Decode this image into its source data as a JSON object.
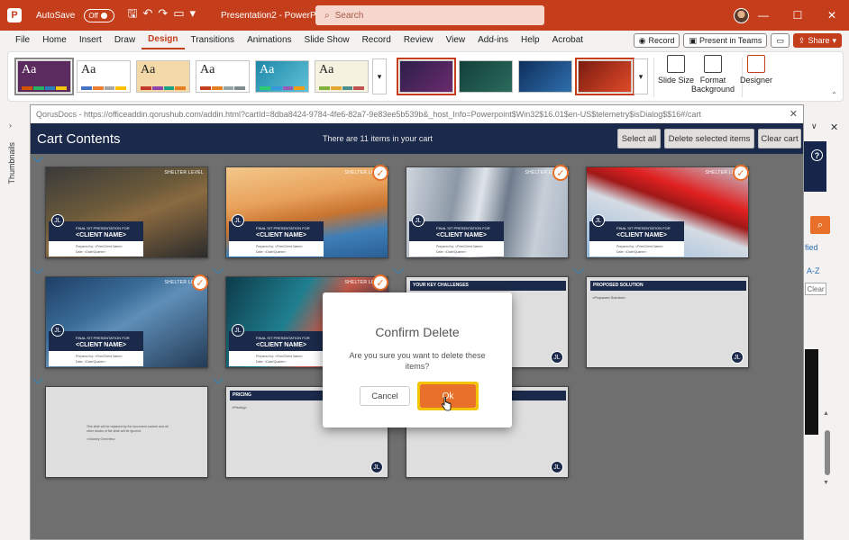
{
  "app": {
    "autosave_label": "AutoSave",
    "autosave_state": "Off",
    "doc_title": "Presentation2 - PowerP...",
    "search_placeholder": "Search"
  },
  "menu": {
    "tabs": [
      "File",
      "Home",
      "Insert",
      "Draw",
      "Design",
      "Transitions",
      "Animations",
      "Slide Show",
      "Record",
      "Review",
      "View",
      "Add-ins",
      "Help",
      "Acrobat"
    ],
    "active": "Design",
    "record_label": "Record",
    "present_label": "Present in Teams",
    "share_label": "Share"
  },
  "ribbon": {
    "theme_label": "Aa",
    "slide_size": "Slide Size",
    "format_background": "Format Background",
    "designer": "Designer"
  },
  "thumbnails_label": "Thumbnails",
  "dialog": {
    "url": "QorusDocs - https://officeaddin.qorushub.com/addin.html?cartId=8dba8424-9784-4fe6-82a7-9e83ee5b539b&_host_Info=Powerpoint$Win32$16.01$en-US$telemetry$isDialog$$16#/cart",
    "cart_title": "Cart Contents",
    "cart_count": "There are 11 items in your cart",
    "btn_select_all": "Select all",
    "btn_delete_selected": "Delete selected items",
    "btn_clear_cart": "Clear cart"
  },
  "slides": {
    "brand": "SHELTER LEVEL",
    "final_caption": "FINAL SIT PRESENTATION FOR",
    "client_name": "<CLIENT NAME>",
    "prepared_by": "Prepared by: <Firm/Client Name>",
    "date": "Date: <Date/Quarter>",
    "key_challenges": "YOUR KEY CHALLENGES",
    "proposed_solution": "PROPOSED SOLUTION",
    "proposed_solution_body": "<Proposed Solution>",
    "pricing": "PRICING",
    "pricing_body": "<Pricing>",
    "replace_text": "This slide will be replaced by the document content and all other blocks of the slide will be ignored.",
    "industry_overview": "<Industry Overview>",
    "logo_glyph": "JL"
  },
  "modal": {
    "title": "Confirm Delete",
    "message": "Are you sure you want to delete these items?",
    "cancel": "Cancel",
    "ok": "Ok"
  },
  "right_pane": {
    "help": "?",
    "modified": "fied",
    "sort": "A-Z",
    "clear": "Clear"
  },
  "colors": {
    "ppt_red": "#c43e1c",
    "navy": "#1b2a4a",
    "orange": "#e8702a",
    "ok_highlight": "#f5c400"
  }
}
